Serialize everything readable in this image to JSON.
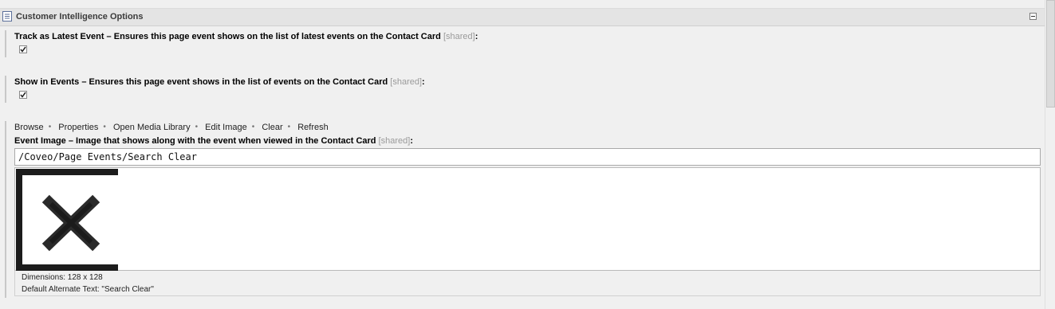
{
  "section": {
    "title": "Customer Intelligence Options"
  },
  "fields": [
    {
      "label": "Track as Latest Event – Ensures this page event shows on the list of latest events on the Contact Card",
      "shared": "[shared]",
      "colon": ":",
      "checked": true
    },
    {
      "label": "Show in Events – Ensures this page event shows in the list of events on the Contact Card",
      "shared": "[shared]",
      "colon": ":",
      "checked": true
    }
  ],
  "image_field": {
    "toolbar": [
      "Browse",
      "Properties",
      "Open Media Library",
      "Edit Image",
      "Clear",
      "Refresh"
    ],
    "label": "Event Image – Image that shows along with the event when viewed in the Contact Card",
    "shared": "[shared]",
    "colon": ":",
    "path": "/Coveo/Page Events/Search Clear",
    "preview_icon": "x-close-icon",
    "dimensions": "Dimensions: 128 x 128",
    "alt_text": "Default Alternate Text: \"Search Clear\""
  }
}
